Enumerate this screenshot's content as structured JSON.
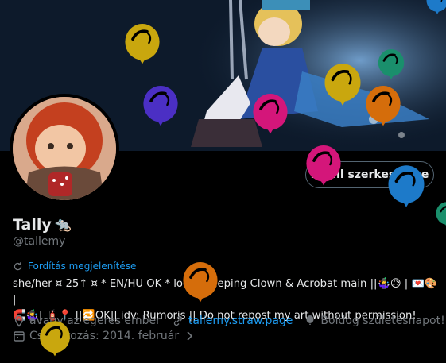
{
  "profile": {
    "edit_button": "Profil szerkesztése",
    "name": "Tally",
    "name_emoji": "🐀",
    "handle": "@tallemy",
    "translate_label": "Fordítás megjelenítése",
    "bio_line1": "she/her ¤ 25↑ ¤ * EN/HU OK * local Weeping Clown & Acrobat main ||🤹‍♀️😥 | 💌🎨 |",
    "bio_line2": "🧲🤹‍♀️| 🧯📍 ||🔁OK|| idv: Rumoris || Do not repost my art without permission!",
    "location": "avagy az egeres ember",
    "website": "tallemy.straw.page",
    "birthday": "Boldog születésnapot!",
    "joined": "Csatlakozás: 2014. február"
  },
  "colors": {
    "accent": "#1d9bf0",
    "muted": "#71767b"
  },
  "balloons": [
    {
      "color": "#c9a70e"
    },
    {
      "color": "#4b2fc4"
    },
    {
      "color": "#d4167a"
    },
    {
      "color": "#c9a70e"
    },
    {
      "color": "#d56d0b"
    },
    {
      "color": "#1a8f6c"
    },
    {
      "color": "#d4167a"
    },
    {
      "color": "#1d7ac9"
    },
    {
      "color": "#1a8f6c"
    },
    {
      "color": "#d56d0b"
    },
    {
      "color": "#c9a70e"
    },
    {
      "color": "#1d7ac9"
    }
  ]
}
